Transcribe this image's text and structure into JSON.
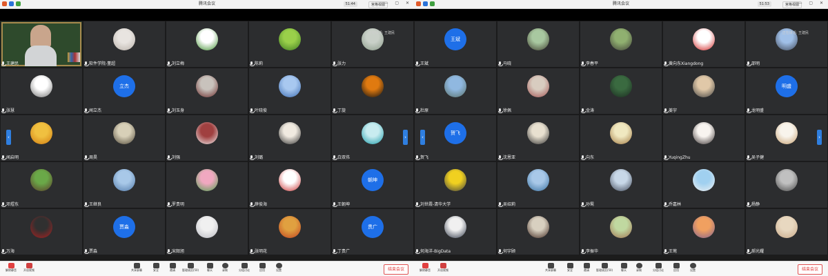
{
  "colors": {
    "accent": "#1e6fe8",
    "end": "#e03838",
    "tile": "#2c2d2f"
  },
  "left": {
    "title": "腾讯会议",
    "clock": "51:44",
    "view_label": "宫格视图",
    "speaking_text": "正在讲话: 王建民",
    "tiles": [
      {
        "name": "王建民",
        "kind": "video"
      },
      {
        "name": "软件学院-董超",
        "kind": "photo",
        "c1": "#e8e4e0",
        "c2": "#b8b0a8"
      },
      {
        "name": "刘立梅",
        "kind": "photo",
        "c1": "#ffffff",
        "c2": "#3f8f2f"
      },
      {
        "name": "陈莉",
        "kind": "photo",
        "c1": "#9ad04a",
        "c2": "#3e7a22"
      },
      {
        "name": "张力",
        "kind": "photo",
        "c1": "#c9d0c8",
        "c2": "#8a9a88"
      },
      {
        "name": "张慧",
        "kind": "photo",
        "c1": "#ffffff",
        "c2": "#707070"
      },
      {
        "name": "闻立杰",
        "kind": "text",
        "avatar_text": "立杰"
      },
      {
        "name": "刘玉身",
        "kind": "photo",
        "c1": "#c8c2bc",
        "c2": "#6a2a2a"
      },
      {
        "name": "叶晓俊",
        "kind": "photo",
        "c1": "#a8c8f0",
        "c2": "#3a6ab0"
      },
      {
        "name": "丁旋",
        "kind": "photo",
        "c1": "#e07a10",
        "c2": "#111111"
      },
      {
        "name": "闻启明",
        "kind": "photo",
        "c1": "#f0c040",
        "c2": "#d07a10"
      },
      {
        "name": "周昊",
        "kind": "photo",
        "c1": "#d8d0b8",
        "c2": "#504838"
      },
      {
        "name": "刘强",
        "kind": "photo",
        "c1": "#a04040",
        "c2": "#f0f0f0"
      },
      {
        "name": "刘璐",
        "kind": "photo",
        "c1": "#f0eae0",
        "c2": "#303030"
      },
      {
        "name": "白双伟",
        "kind": "photo",
        "c1": "#c8ecf0",
        "c2": "#1a9aa8"
      },
      {
        "name": "邓煜东",
        "kind": "photo",
        "c1": "#6aa848",
        "c2": "#5a3a2a"
      },
      {
        "name": "王继良",
        "kind": "photo",
        "c1": "#a8c8e8",
        "c2": "#5078a8"
      },
      {
        "name": "罗贵明",
        "kind": "photo",
        "c1": "#f0a8c0",
        "c2": "#50a050"
      },
      {
        "name": "薛俊海",
        "kind": "photo",
        "c1": "#ffffff",
        "c2": "#c83030"
      },
      {
        "name": "王朝坤",
        "kind": "text",
        "avatar_text": "朝坤"
      },
      {
        "name": "万海",
        "kind": "photo",
        "c1": "#303030",
        "c2": "#b02020"
      },
      {
        "name": "贾淼",
        "kind": "text",
        "avatar_text": "贾淼"
      },
      {
        "name": "宋韶旭",
        "kind": "photo",
        "c1": "#f0f0f0",
        "c2": "#b8b8c0"
      },
      {
        "name": "张明花",
        "kind": "photo",
        "c1": "#e0a040",
        "c2": "#c04020"
      },
      {
        "name": "丁贵广",
        "kind": "text",
        "avatar_text": "贵广"
      }
    ]
  },
  "right": {
    "title": "腾讯会议",
    "clock": "51:53",
    "view_label": "宫格视图",
    "speaking_text": "正在讲话: 王建民",
    "tiles": [
      {
        "name": "王斌",
        "kind": "text",
        "avatar_text": "王斌"
      },
      {
        "name": "马晓",
        "kind": "photo",
        "c1": "#a8c8a0",
        "c2": "#404030"
      },
      {
        "name": "李春平",
        "kind": "photo",
        "c1": "#90b070",
        "c2": "#404038"
      },
      {
        "name": "黄向东Xiangdong",
        "kind": "photo",
        "c1": "#ffffff",
        "c2": "#d02020"
      },
      {
        "name": "邵明",
        "kind": "photo",
        "c1": "#a0c0e8",
        "c2": "#404858"
      },
      {
        "name": "杜原",
        "kind": "photo",
        "c1": "#90b8e0",
        "c2": "#587068"
      },
      {
        "name": "徐佩",
        "kind": "photo",
        "c1": "#d8ccc0",
        "c2": "#a05050"
      },
      {
        "name": "金涛",
        "kind": "photo",
        "c1": "#3a6a40",
        "c2": "#1a2a20"
      },
      {
        "name": "姜宇",
        "kind": "photo",
        "c1": "#e0c8a8",
        "c2": "#404040"
      },
      {
        "name": "龙明盛",
        "kind": "text",
        "avatar_text": "明盛"
      },
      {
        "name": "贺飞",
        "kind": "text",
        "avatar_text": "贺飞"
      },
      {
        "name": "沈恩亚",
        "kind": "photo",
        "c1": "#e8e0d0",
        "c2": "#303030"
      },
      {
        "name": "向东",
        "kind": "photo",
        "c1": "#f0e8c0",
        "c2": "#a07840"
      },
      {
        "name": "YuqingZhu",
        "kind": "photo",
        "c1": "#f8f4f0",
        "c2": "#383030"
      },
      {
        "name": "吴子健",
        "kind": "photo",
        "c1": "#f8f4ec",
        "c2": "#c8a070"
      },
      {
        "name": "刘世霞-清华大学",
        "kind": "photo",
        "c1": "#f0d020",
        "c2": "#404040"
      },
      {
        "name": "吴绍莉",
        "kind": "photo",
        "c1": "#a8c8e8",
        "c2": "#3870a0"
      },
      {
        "name": "孙鸳",
        "kind": "photo",
        "c1": "#c8d8e8",
        "c2": "#404858"
      },
      {
        "name": "乔嘉林",
        "kind": "photo",
        "c1": "#a0d0f0",
        "c2": "#f0f0f0"
      },
      {
        "name": "杨静",
        "kind": "photo",
        "c1": "#c0c0c0",
        "c2": "#484848"
      },
      {
        "name": "何海洋-BigData",
        "kind": "photo",
        "c1": "#f0f0f0",
        "c2": "#303848"
      },
      {
        "name": "何宇顾",
        "kind": "photo",
        "c1": "#d8d0c0",
        "c2": "#402820"
      },
      {
        "name": "李振华",
        "kind": "photo",
        "c1": "#c0d8a0",
        "c2": "#a07050"
      },
      {
        "name": "王莺",
        "kind": "photo",
        "c1": "#f0a060",
        "c2": "#806090"
      },
      {
        "name": "郝光耀",
        "kind": "photo",
        "c1": "#e8d8c0",
        "c2": "#c8a888"
      }
    ]
  },
  "toolbar": {
    "unmute": "解除静音",
    "camera": "开启视频",
    "share": "共享屏幕",
    "security": "安全",
    "invite": "邀请",
    "manage": "管理成员(50)",
    "chat": "聊天",
    "record": "录制",
    "breakout": "分组讨论",
    "apps": "应用",
    "settings": "设置",
    "end": "结束会议"
  }
}
